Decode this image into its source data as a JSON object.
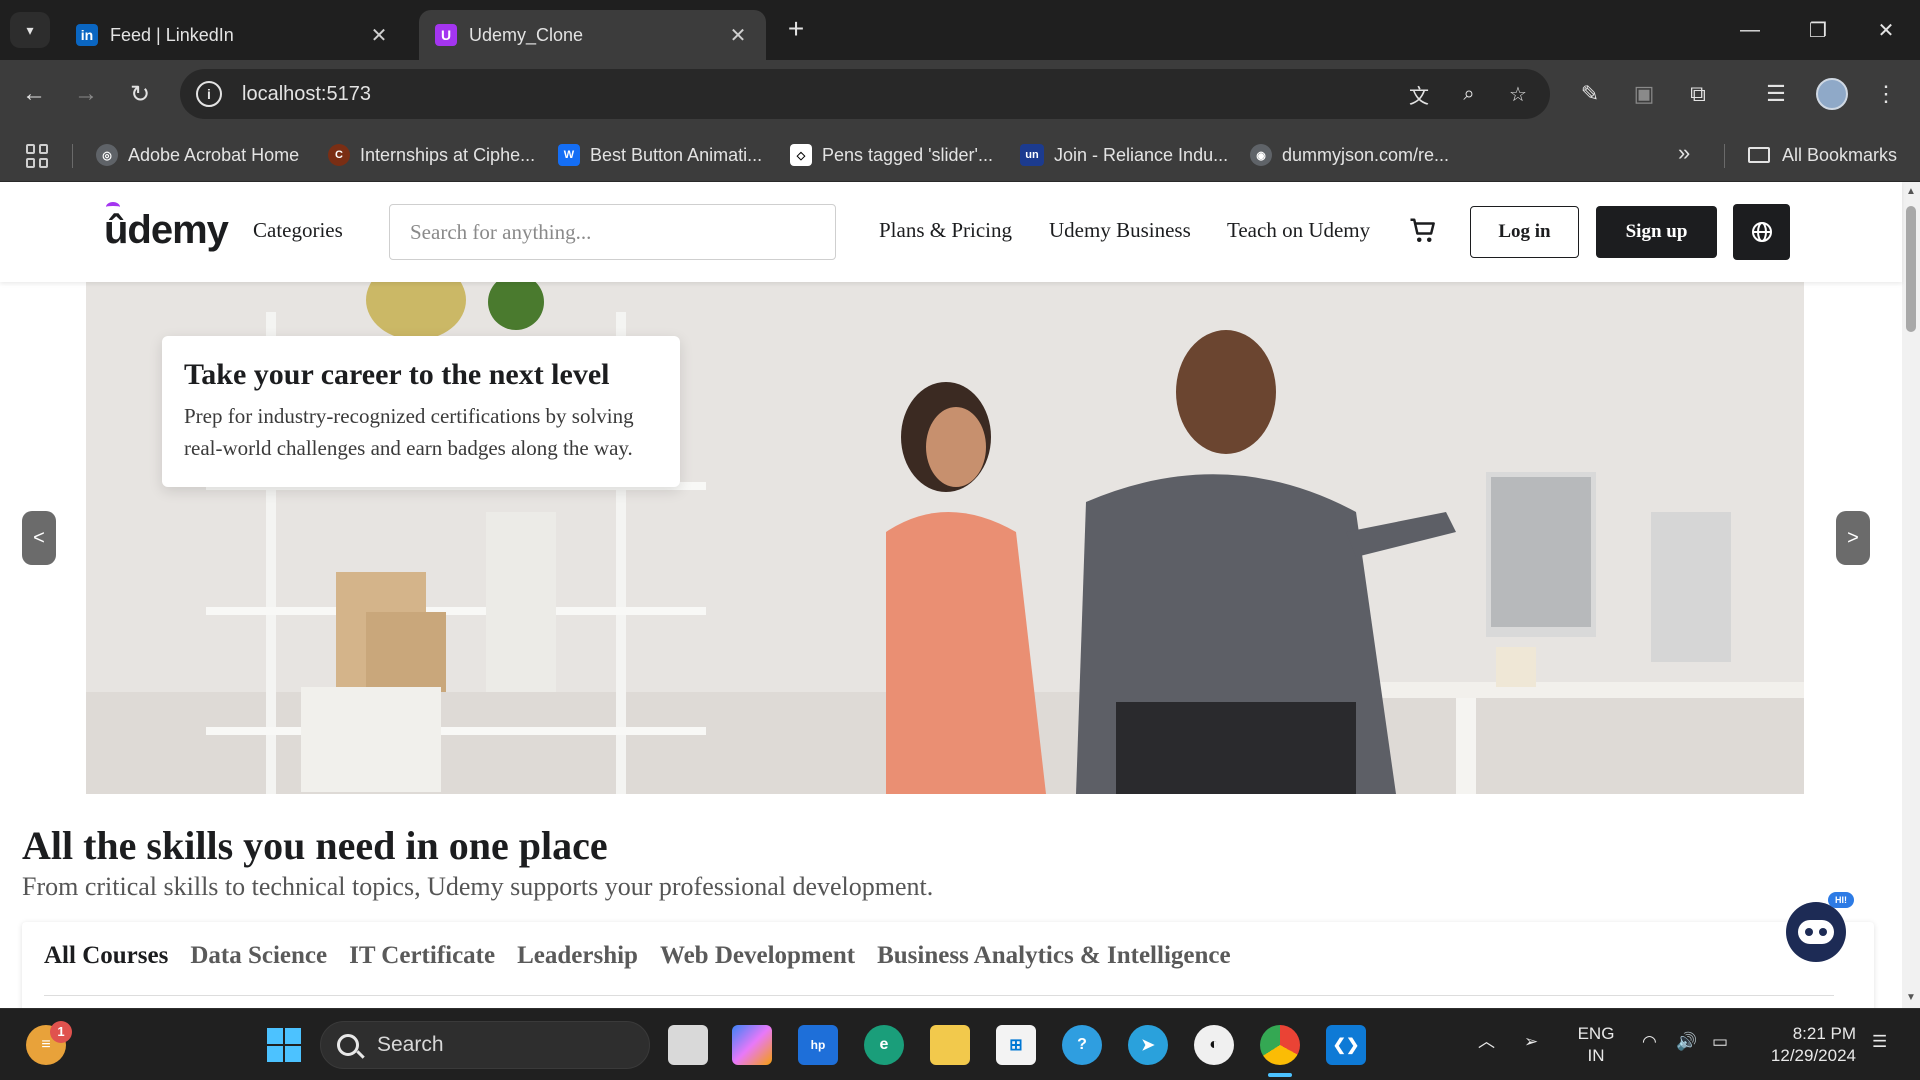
{
  "browser": {
    "tabs": [
      {
        "title": "Feed | LinkedIn",
        "icon": "linkedin-icon",
        "active": false
      },
      {
        "title": "Udemy_Clone",
        "icon": "udemy-icon",
        "active": true
      }
    ],
    "url": "localhost:5173",
    "bookmarks": [
      {
        "label": "Adobe Acrobat Home",
        "icon": "acrobat-icon"
      },
      {
        "label": "Internships at Ciphe...",
        "icon": "cipher-icon"
      },
      {
        "label": "Best Button Animati...",
        "icon": "webflow-icon"
      },
      {
        "label": "Pens tagged 'slider'...",
        "icon": "codepen-icon"
      },
      {
        "label": "Join - Reliance Indu...",
        "icon": "unstop-icon"
      },
      {
        "label": "dummyjson.com/re...",
        "icon": "globe-icon"
      }
    ],
    "more_bookmarks": "»",
    "all_bookmarks": "All Bookmarks"
  },
  "site": {
    "logo": "ûdemy",
    "categories": "Categories",
    "search_placeholder": "Search for anything...",
    "nav": [
      "Plans & Pricing",
      "Udemy Business",
      "Teach on Udemy"
    ],
    "login": "Log in",
    "signup": "Sign up",
    "accent": "#a435f0"
  },
  "hero": {
    "title": "Take your career to the next level",
    "text": "Prep for industry-recognized certifications by solving real-world challenges and earn badges along the way.",
    "prev": "<",
    "next": ">"
  },
  "skills": {
    "title": "All the skills you need in one place",
    "subtitle": "From critical skills to technical topics, Udemy supports your professional development.",
    "tabs": [
      "All Courses",
      "Data Science",
      "IT Certificate",
      "Leadership",
      "Web Development",
      "Business Analytics & Intelligence"
    ],
    "active_tab": "All Courses"
  },
  "chatbot": {
    "badge": "HI!"
  },
  "taskbar": {
    "search_label": "Search",
    "notification_count": "1",
    "language": "ENG",
    "region": "IN",
    "time": "8:21 PM",
    "date": "12/29/2024"
  }
}
